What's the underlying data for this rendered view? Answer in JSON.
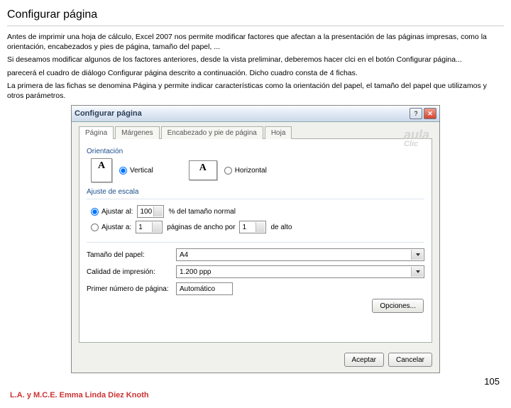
{
  "page": {
    "title": "Configurar página",
    "para1": "Antes de imprimir una hoja de cálculo, Excel 2007 nos permite modificar factores que afectan a la presentación de las páginas impresas, como la orientación, encabezados y pies de página, tamaño del papel, ...",
    "para2": "Si deseamos modificar algunos de los factores anteriores, desde la vista preliminar, deberemos hacer clci en el botón Configurar página...",
    "para3": "parecerá el cuadro de diálogo Configurar página descrito a continuación. Dicho cuadro consta de 4 fichas.",
    "para4": "La primera de las fichas se denomina Página y permite indicar características como la orientación del papel, el tamaño del papel que utilizamos y otros parámetros.",
    "pageNumber": "105",
    "author": "L.A. y M.C.E. Emma Linda Diez Knoth"
  },
  "dialog": {
    "title": "Configurar página",
    "tabs": [
      "Página",
      "Márgenes",
      "Encabezado y pie de página",
      "Hoja"
    ],
    "groups": {
      "orientation": "Orientación",
      "scaling": "Ajuste de escala"
    },
    "orientation": {
      "vertical": "Vertical",
      "horizontal": "Horizontal",
      "thumb": "A"
    },
    "scaling": {
      "adjustTo": "Ajustar al:",
      "adjustValue": "100",
      "adjustSuffix": "% del tamaño normal",
      "fitTo": "Ajustar a:",
      "fitWide": "1",
      "fitWideLabel": "páginas de ancho por",
      "fitTall": "1",
      "fitTallLabel": "de alto"
    },
    "fields": {
      "paperSizeLabel": "Tamaño del papel:",
      "paperSizeValue": "A4",
      "qualityLabel": "Calidad de impresión:",
      "qualityValue": "1.200 ppp",
      "firstPageLabel": "Primer número de página:",
      "firstPageValue": "Automático"
    },
    "buttons": {
      "options": "Opciones...",
      "ok": "Aceptar",
      "cancel": "Cancelar"
    },
    "watermark": {
      "brand": "aula",
      "sub": "Clic"
    }
  }
}
